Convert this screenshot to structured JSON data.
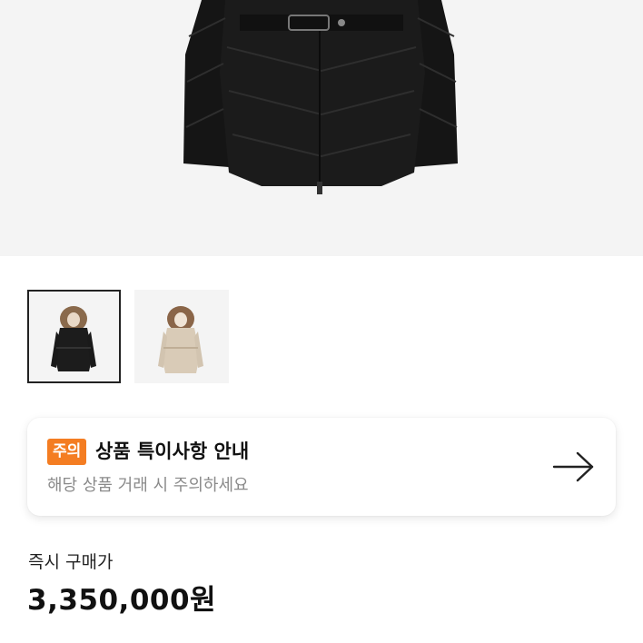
{
  "product": {
    "main_image": "black-down-jacket-with-belt",
    "thumbnails": [
      {
        "name": "black-fur-hood-jacket",
        "selected": true
      },
      {
        "name": "beige-fur-hood-jacket",
        "selected": false
      }
    ]
  },
  "notice": {
    "tag": "주의",
    "tag_color": "#f47d22",
    "title": "상품 특이사항 안내",
    "subtitle": "해당 상품 거래 시 주의하세요",
    "arrow_icon": "arrow-right-icon"
  },
  "price": {
    "label": "즉시 구매가",
    "value": "3,350,000원"
  }
}
